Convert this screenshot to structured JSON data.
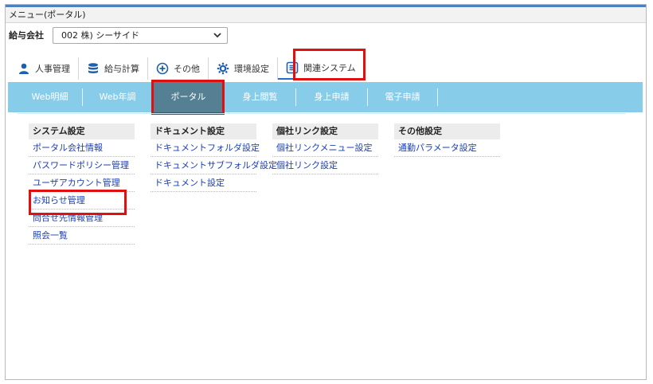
{
  "window": {
    "title": "メニュー(ポータル)"
  },
  "company": {
    "label": "給与会社",
    "selected": "002 株) シーサイド"
  },
  "top_tabs": [
    {
      "label": "人事管理",
      "icon": "person-icon"
    },
    {
      "label": "給与計算",
      "icon": "database-icon"
    },
    {
      "label": "その他",
      "icon": "plus-circle-icon"
    },
    {
      "label": "環境設定",
      "icon": "gear-icon"
    },
    {
      "label": "関連システム",
      "icon": "list-document-icon"
    }
  ],
  "nav": {
    "items": [
      "Web明細",
      "Web年調",
      "ポータル",
      "身上閲覧",
      "身上申請",
      "電子申請"
    ],
    "active_index": 2
  },
  "menu": {
    "system": {
      "title": "システム設定",
      "items": [
        "ポータル会社情報",
        "パスワードポリシー管理",
        "ユーザアカウント管理",
        "お知らせ管理",
        "問合せ先情報管理",
        "照会一覧"
      ]
    },
    "document": {
      "title": "ドキュメント設定",
      "items": [
        "ドキュメントフォルダ設定",
        "ドキュメントサブフォルダ設定",
        "ドキュメント設定"
      ]
    },
    "link": {
      "title": "個社リンク設定",
      "items": [
        "個社リンクメニュー設定",
        "個社リンク設定"
      ]
    },
    "other": {
      "title": "その他設定",
      "items": [
        "通勤パラメータ設定"
      ]
    }
  },
  "colors": {
    "nav_bg": "#87cdea",
    "nav_active": "#557f92",
    "link": "#1a3fb5",
    "highlight": "#e01010"
  }
}
